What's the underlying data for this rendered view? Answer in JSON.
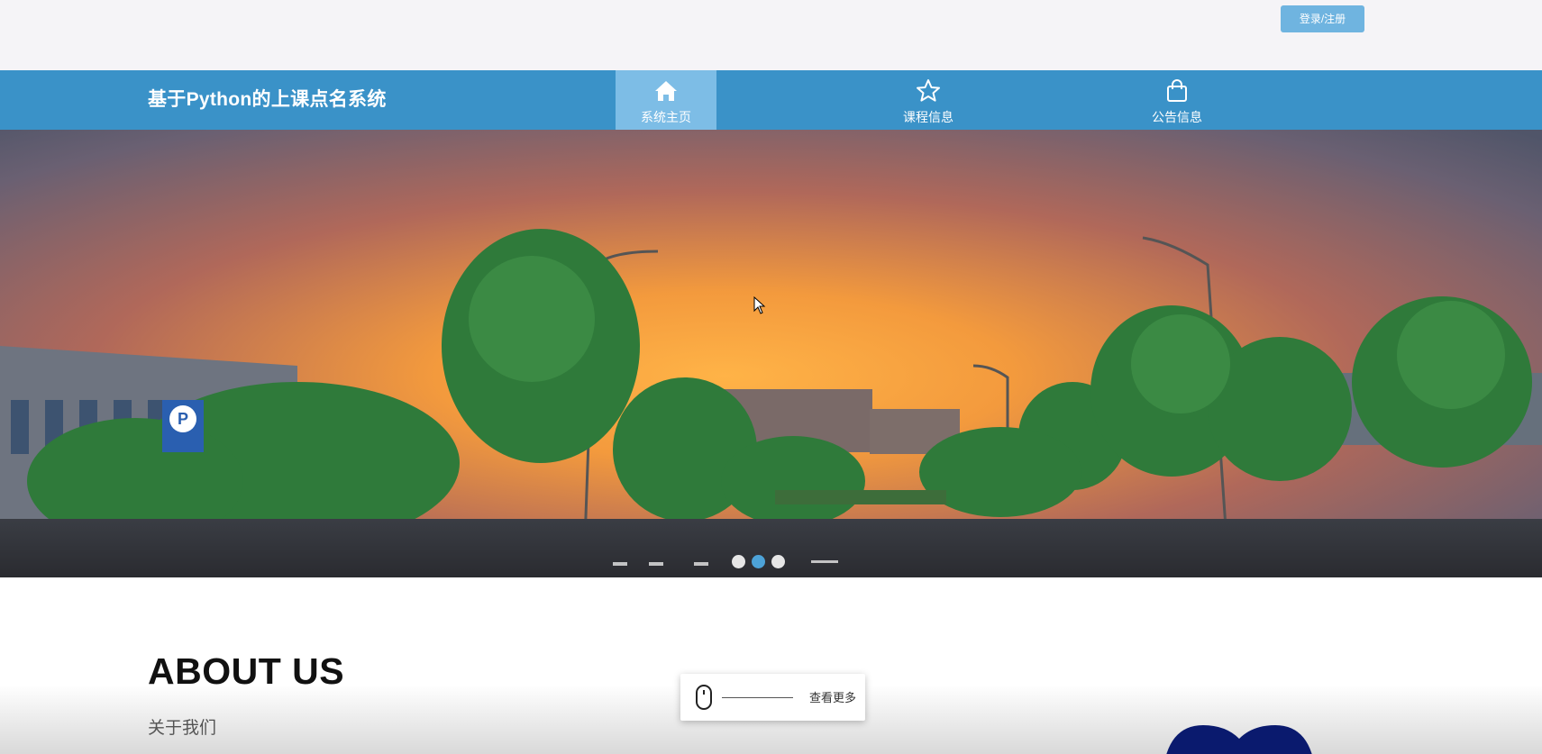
{
  "header": {
    "login_label": "登录/注册"
  },
  "nav": {
    "site_title": "基于Python的上课点名系统",
    "items": [
      {
        "label": "系统主页",
        "icon": "home-icon",
        "active": true
      },
      {
        "label": "课程信息",
        "icon": "star-icon",
        "active": false
      },
      {
        "label": "公告信息",
        "icon": "shopping-bag-icon",
        "active": false
      }
    ]
  },
  "banner": {
    "slide_count": 3,
    "active_slide": 2
  },
  "about": {
    "title": "ABOUT US",
    "subtitle": "关于我们"
  },
  "scroll_hint": {
    "label": "查看更多",
    "icon": "mouse-icon"
  },
  "colors": {
    "nav_bg": "#3a92c8",
    "nav_active": "#7dbde6",
    "login_btn": "#6fb4e0"
  }
}
